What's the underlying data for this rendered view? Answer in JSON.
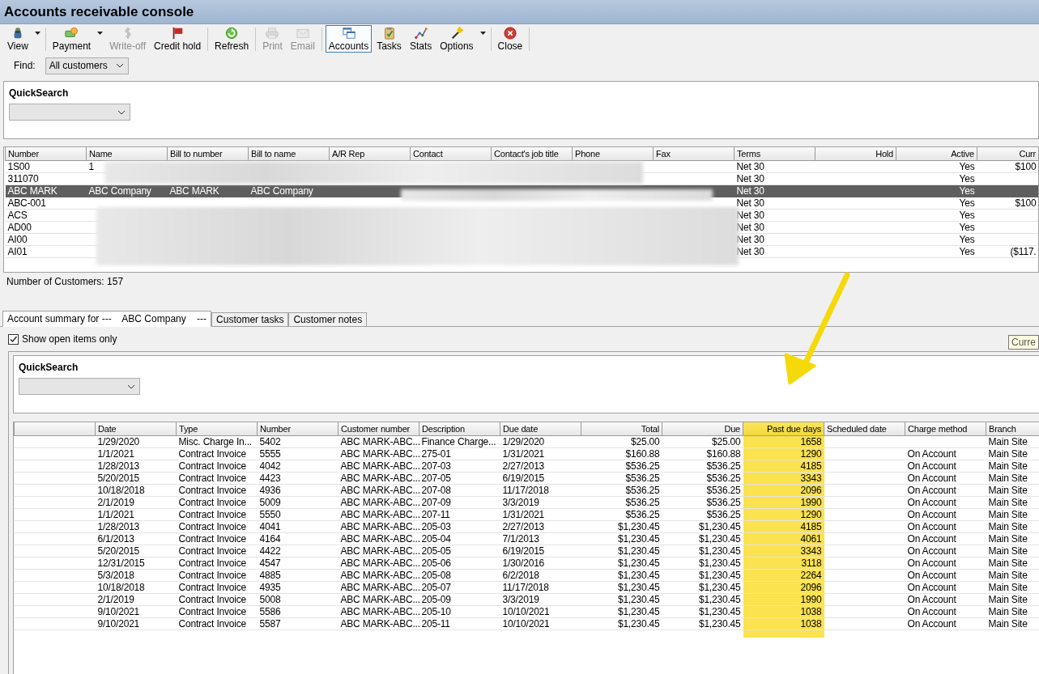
{
  "window": {
    "title": "Accounts receivable console"
  },
  "toolbar": [
    {
      "buttons": [
        {
          "label": "View",
          "dropdown": true,
          "disabled": false,
          "selected": false
        }
      ]
    },
    {
      "buttons": [
        {
          "label": "Payment",
          "dropdown": true,
          "disabled": false,
          "selected": false
        },
        {
          "label": "Write-off",
          "dropdown": false,
          "disabled": true,
          "selected": false
        },
        {
          "label": "Credit hold",
          "dropdown": false,
          "disabled": false,
          "selected": false
        }
      ]
    },
    {
      "buttons": [
        {
          "label": "Refresh",
          "dropdown": false,
          "disabled": false,
          "selected": false
        }
      ]
    },
    {
      "buttons": [
        {
          "label": "Print",
          "dropdown": false,
          "disabled": true,
          "selected": false
        },
        {
          "label": "Email",
          "dropdown": false,
          "disabled": true,
          "selected": false
        }
      ]
    },
    {
      "buttons": [
        {
          "label": "Accounts",
          "dropdown": false,
          "disabled": false,
          "selected": true
        },
        {
          "label": "Tasks",
          "dropdown": false,
          "disabled": false,
          "selected": false
        },
        {
          "label": "Stats",
          "dropdown": false,
          "disabled": false,
          "selected": false
        },
        {
          "label": "Options",
          "dropdown": true,
          "disabled": false,
          "selected": false
        }
      ]
    },
    {
      "buttons": [
        {
          "label": "Close",
          "dropdown": false,
          "disabled": false,
          "selected": false
        }
      ]
    }
  ],
  "find": {
    "label": "Find:",
    "value": "All customers"
  },
  "customer_search": {
    "label": "QuickSearch"
  },
  "customers": {
    "columns": [
      {
        "label": "Number"
      },
      {
        "label": "Name"
      },
      {
        "label": "Bill to number"
      },
      {
        "label": "Bill to name"
      },
      {
        "label": "A/R Rep"
      },
      {
        "label": "Contact"
      },
      {
        "label": "Contact's job title"
      },
      {
        "label": "Phone"
      },
      {
        "label": "Fax"
      },
      {
        "label": "Terms"
      },
      {
        "label": "Hold",
        "right_aligned": true
      },
      {
        "label": "Active",
        "right_aligned": true
      },
      {
        "label": "Curr",
        "right_aligned": true
      }
    ],
    "rows": [
      {
        "selected": false,
        "cells": [
          "1S00",
          "1",
          null,
          null,
          null,
          null,
          null,
          null,
          null,
          "Net 30",
          null,
          "Yes",
          "$100"
        ]
      },
      {
        "selected": false,
        "cells": [
          "311070",
          null,
          null,
          null,
          null,
          null,
          null,
          null,
          null,
          "Net 30",
          null,
          "Yes",
          null
        ]
      },
      {
        "selected": true,
        "cells": [
          "ABC MARK",
          "ABC Company",
          "ABC MARK",
          "ABC Company",
          null,
          null,
          null,
          null,
          null,
          "Net 30",
          null,
          "Yes",
          null
        ]
      },
      {
        "selected": false,
        "cells": [
          "ABC-001",
          null,
          null,
          null,
          null,
          null,
          null,
          null,
          null,
          "Net 30",
          null,
          "Yes",
          "$100"
        ]
      },
      {
        "selected": false,
        "cells": [
          "ACS",
          null,
          null,
          null,
          null,
          null,
          null,
          null,
          null,
          "Net 30",
          null,
          "Yes",
          null
        ]
      },
      {
        "selected": false,
        "cells": [
          "AD00",
          null,
          null,
          null,
          null,
          null,
          null,
          null,
          null,
          "Net 30",
          null,
          "Yes",
          null
        ]
      },
      {
        "selected": false,
        "cells": [
          "AI00",
          null,
          null,
          null,
          null,
          null,
          null,
          null,
          null,
          "Net 30",
          null,
          "Yes",
          null
        ]
      },
      {
        "selected": false,
        "cells": [
          "AI01",
          null,
          null,
          null,
          null,
          null,
          null,
          null,
          null,
          "Net 30",
          null,
          "Yes",
          "($117."
        ]
      }
    ],
    "count": "Number of Customers: 157"
  },
  "tabs": [
    {
      "label": "Account summary for ---    ABC Company    ---",
      "selected": true
    },
    {
      "label": "Customer tasks",
      "selected": false
    },
    {
      "label": "Customer notes",
      "selected": false
    }
  ],
  "open_items_only": {
    "label": "Show open items only",
    "checked": true
  },
  "tooltip": "Curre",
  "items_search": {
    "label": "QuickSearch"
  },
  "items": {
    "columns": [
      {
        "label": "Date",
        "highlighted": false
      },
      {
        "label": "Type",
        "highlighted": false
      },
      {
        "label": "Number",
        "highlighted": false
      },
      {
        "label": "Customer number",
        "highlighted": false
      },
      {
        "label": "Description",
        "highlighted": false
      },
      {
        "label": "Due date",
        "highlighted": false
      },
      {
        "label": "Total",
        "right_aligned": true,
        "highlighted": false
      },
      {
        "label": "Due",
        "right_aligned": true,
        "highlighted": false
      },
      {
        "label": "Past due days",
        "right_aligned": true,
        "highlighted": true
      },
      {
        "label": "Scheduled date",
        "highlighted": false
      },
      {
        "label": "Charge method",
        "highlighted": false
      },
      {
        "label": "Branch",
        "highlighted": false
      }
    ],
    "rows": [
      [
        "1/29/2020",
        "Misc. Charge In...",
        "5402",
        "ABC MARK-ABC...",
        "Finance Charge...",
        "1/29/2020",
        "$25.00",
        "$25.00",
        "1658",
        null,
        null,
        "Main Site"
      ],
      [
        "1/1/2021",
        "Contract Invoice",
        "5555",
        "ABC MARK-ABC...",
        "275-01",
        "1/31/2021",
        "$160.88",
        "$160.88",
        "1290",
        null,
        "On Account",
        "Main Site"
      ],
      [
        "1/28/2013",
        "Contract Invoice",
        "4042",
        "ABC MARK-ABC...",
        "207-03",
        "2/27/2013",
        "$536.25",
        "$536.25",
        "4185",
        null,
        "On Account",
        "Main Site"
      ],
      [
        "5/20/2015",
        "Contract Invoice",
        "4423",
        "ABC MARK-ABC...",
        "207-05",
        "6/19/2015",
        "$536.25",
        "$536.25",
        "3343",
        null,
        "On Account",
        "Main Site"
      ],
      [
        "10/18/2018",
        "Contract Invoice",
        "4936",
        "ABC MARK-ABC...",
        "207-08",
        "11/17/2018",
        "$536.25",
        "$536.25",
        "2096",
        null,
        "On Account",
        "Main Site"
      ],
      [
        "2/1/2019",
        "Contract Invoice",
        "5009",
        "ABC MARK-ABC...",
        "207-09",
        "3/3/2019",
        "$536.25",
        "$536.25",
        "1990",
        null,
        "On Account",
        "Main Site"
      ],
      [
        "1/1/2021",
        "Contract Invoice",
        "5550",
        "ABC MARK-ABC...",
        "207-11",
        "1/31/2021",
        "$536.25",
        "$536.25",
        "1290",
        null,
        "On Account",
        "Main Site"
      ],
      [
        "1/28/2013",
        "Contract Invoice",
        "4041",
        "ABC MARK-ABC...",
        "205-03",
        "2/27/2013",
        "$1,230.45",
        "$1,230.45",
        "4185",
        null,
        "On Account",
        "Main Site"
      ],
      [
        "6/1/2013",
        "Contract Invoice",
        "4164",
        "ABC MARK-ABC...",
        "205-04",
        "7/1/2013",
        "$1,230.45",
        "$1,230.45",
        "4061",
        null,
        "On Account",
        "Main Site"
      ],
      [
        "5/20/2015",
        "Contract Invoice",
        "4422",
        "ABC MARK-ABC...",
        "205-05",
        "6/19/2015",
        "$1,230.45",
        "$1,230.45",
        "3343",
        null,
        "On Account",
        "Main Site"
      ],
      [
        "12/31/2015",
        "Contract Invoice",
        "4547",
        "ABC MARK-ABC...",
        "205-06",
        "1/30/2016",
        "$1,230.45",
        "$1,230.45",
        "3118",
        null,
        "On Account",
        "Main Site"
      ],
      [
        "5/3/2018",
        "Contract Invoice",
        "4885",
        "ABC MARK-ABC...",
        "205-08",
        "6/2/2018",
        "$1,230.45",
        "$1,230.45",
        "2264",
        null,
        "On Account",
        "Main Site"
      ],
      [
        "10/18/2018",
        "Contract Invoice",
        "4935",
        "ABC MARK-ABC...",
        "205-07",
        "11/17/2018",
        "$1,230.45",
        "$1,230.45",
        "2096",
        null,
        "On Account",
        "Main Site"
      ],
      [
        "2/1/2019",
        "Contract Invoice",
        "5008",
        "ABC MARK-ABC...",
        "205-09",
        "3/3/2019",
        "$1,230.45",
        "$1,230.45",
        "1990",
        null,
        "On Account",
        "Main Site"
      ],
      [
        "9/10/2021",
        "Contract Invoice",
        "5586",
        "ABC MARK-ABC...",
        "205-10",
        "10/10/2021",
        "$1,230.45",
        "$1,230.45",
        "1038",
        null,
        "On Account",
        "Main Site"
      ],
      [
        "9/10/2021",
        "Contract Invoice",
        "5587",
        "ABC MARK-ABC...",
        "205-11",
        "10/10/2021",
        "$1,230.45",
        "$1,230.45",
        "1038",
        null,
        "On Account",
        "Main Site"
      ]
    ]
  }
}
